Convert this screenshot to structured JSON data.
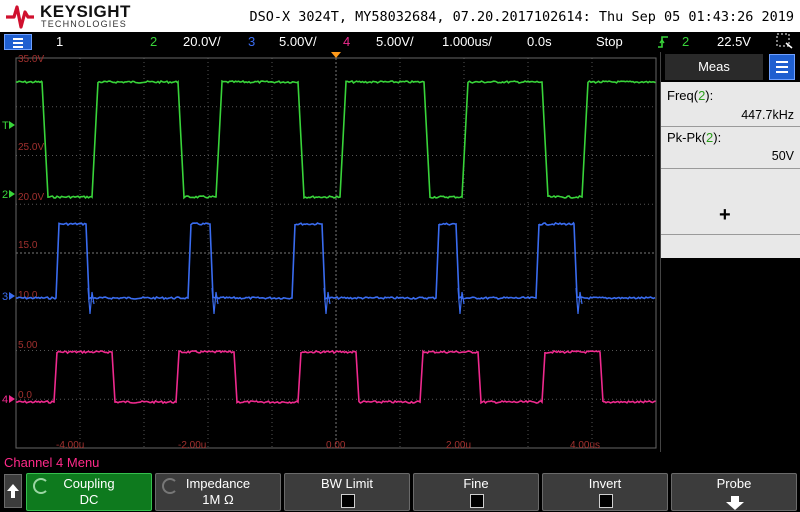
{
  "header": {
    "brand": "KEYSIGHT",
    "brand_sub": "TECHNOLOGIES",
    "device_info": "DSO-X 3024T, MY58032684, 07.20.2017102614: Thu Sep 05 01:43:26 2019",
    "logo_icon": "keysight-wave-icon",
    "logo_color": "#d0102e"
  },
  "status": {
    "menu_icon": "menu-list-icon",
    "ch1": "1",
    "ch2": "2",
    "ch2_scale": "20.0V/",
    "ch3": "3",
    "ch3_scale": "5.00V/",
    "ch4": "4",
    "ch4_scale": "5.00V/",
    "timebase": "1.000us/",
    "delay": "0.0s",
    "run_state": "Stop",
    "trigger_icon": "trigger-edge-icon",
    "trigger_source": "2",
    "trigger_level": "22.5V",
    "run_icon": "acquire-mode-icon"
  },
  "scope": {
    "channel_markers": {
      "trigger": "T",
      "ch2": "2",
      "ch3": "3",
      "ch4": "4"
    },
    "grid_labels": {
      "ch2_top": "35.0V",
      "ch2_mid": "25.0V",
      "ch2_low": "20.0V",
      "ch3_high": "15.0",
      "ch3_low": "10.0",
      "ch4_high": "5.00",
      "ch4_low": "0.0"
    },
    "time_labels": [
      "-4.00u",
      "-2.00u",
      "0.00",
      "2.00u",
      "4.00us"
    ],
    "colors": {
      "ch2": "#39d43a",
      "ch3": "#3a6cf0",
      "ch4": "#ef2a8e",
      "trigger_marker": "#ff9a1a",
      "grid": "#555555",
      "grid_label": "#a0302e"
    }
  },
  "meas": {
    "tab_label": "Meas",
    "settings_icon": "meas-menu-icon",
    "items": [
      {
        "label": "Freq(",
        "channel": "2",
        "suffix": "):",
        "value": "447.7kHz"
      },
      {
        "label": "Pk-Pk(",
        "channel": "2",
        "suffix": "):",
        "value": "50V"
      }
    ],
    "add_icon": "plus-icon"
  },
  "bottom": {
    "menu_title": "Channel 4 Menu",
    "up_icon": "up-arrow-icon",
    "softkeys": [
      {
        "title": "Coupling",
        "value": "DC",
        "active": true
      },
      {
        "title": "Impedance",
        "value": "1M Ω"
      },
      {
        "title": "BW Limit",
        "checkbox": true
      },
      {
        "title": "Fine",
        "checkbox": true
      },
      {
        "title": "Invert",
        "checkbox": true
      },
      {
        "title": "Probe",
        "icon": "down-arrow-icon"
      }
    ]
  }
}
